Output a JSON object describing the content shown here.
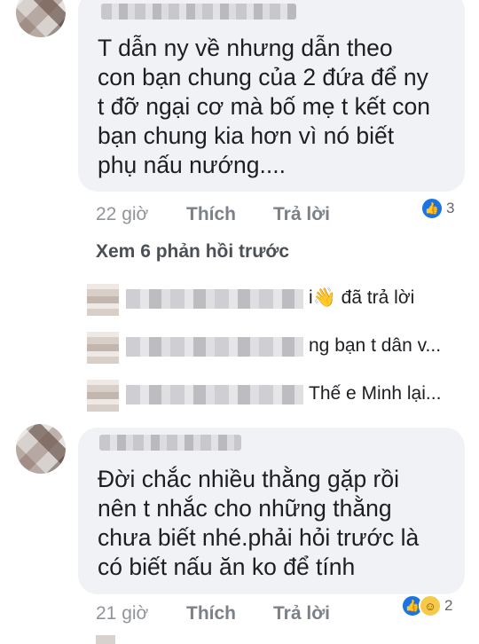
{
  "comment1": {
    "text_lines": [
      "T dẫn ny về nhưng dẫn theo",
      "con bạn chung của 2 đứa để ny",
      "t đỡ ngại cơ mà bố mẹ t kết con",
      "bạn chung kia hơn vì nó biết",
      "phụ nấu nướng...."
    ],
    "time": "22 giờ",
    "like_label": "Thích",
    "reply_label": "Trả lời",
    "reaction_count": "3"
  },
  "see_more": "Xem 6 phản hồi trước",
  "replies": [
    {
      "text": "i👋 đã trả lời"
    },
    {
      "text": "ng bạn t dân v..."
    },
    {
      "text": "Thế e Minh lại..."
    }
  ],
  "comment2": {
    "text_lines": [
      "Đời chắc nhiều thằng gặp rồi",
      "nên t nhắc cho những thằng",
      "chưa biết nhé.phải hỏi trước là",
      "có biết nấu ăn ko để tính"
    ],
    "time": "21 giờ",
    "like_label": "Thích",
    "reply_label": "Trả lời",
    "reaction_count": "2"
  },
  "icons": {
    "like": "thumbs-up-icon",
    "haha": "laughing-face-icon",
    "reply": "wave-hand-icon"
  },
  "colors": {
    "bubble": "#f0f2f5",
    "like_blue": "#1b74e4",
    "meta_gray": "#90949c"
  }
}
